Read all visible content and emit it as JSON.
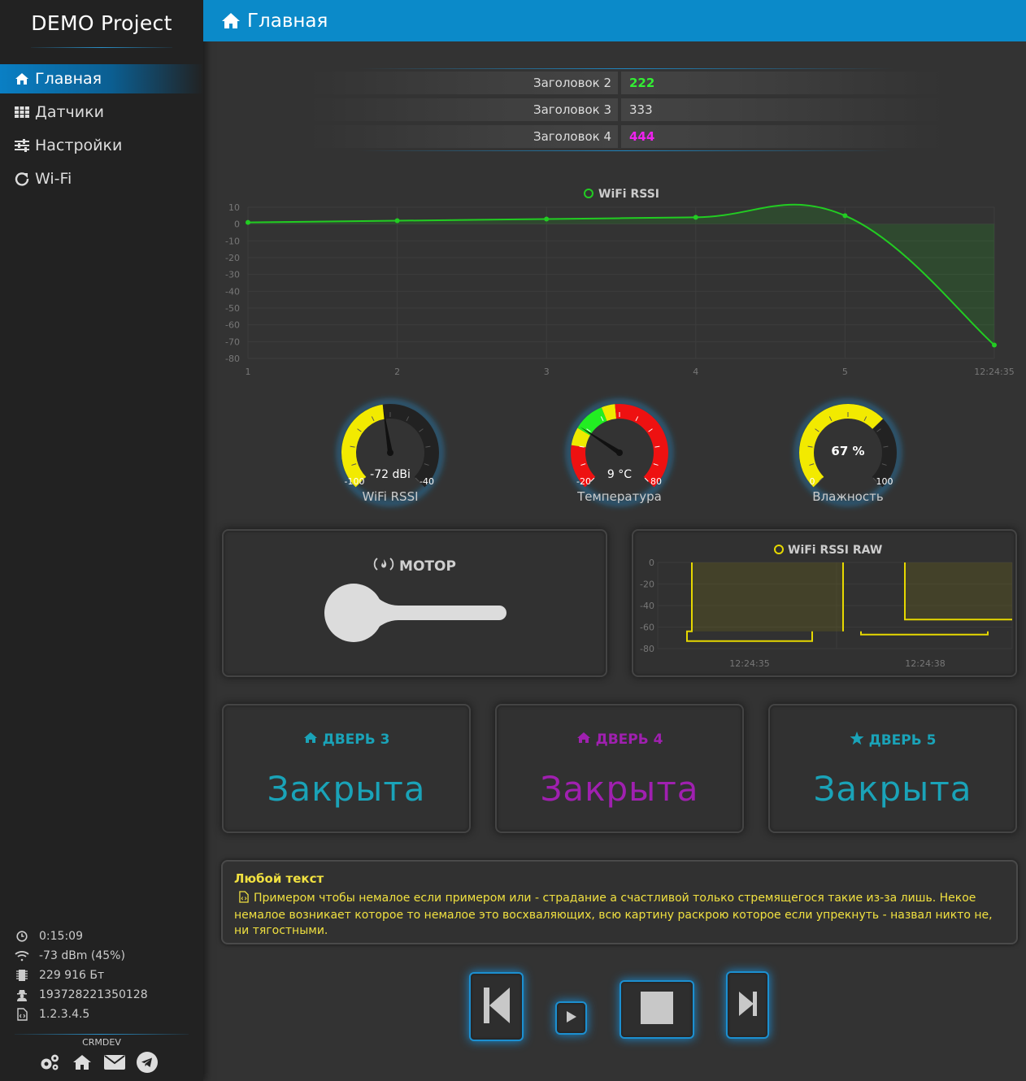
{
  "sidebar": {
    "brand": "DEMO Project",
    "items": [
      {
        "label": "Главная",
        "icon": "home-icon",
        "active": true
      },
      {
        "label": "Датчики",
        "icon": "grid-icon",
        "active": false
      },
      {
        "label": "Настройки",
        "icon": "sliders-icon",
        "active": false
      },
      {
        "label": "Wi-Fi",
        "icon": "refresh-icon",
        "active": false
      }
    ],
    "system": {
      "uptime": "0:15:09",
      "signal": "-73 dBm (45%)",
      "memory": "229 916 Бт",
      "chip_id": "193728221350128",
      "firmware": "1.2.3.4.5"
    },
    "footer": {
      "brand": "CRMDEV"
    }
  },
  "header": {
    "title": "Главная"
  },
  "info_table": [
    {
      "label": "Заголовок 2",
      "value": "222",
      "color": "#33ee33"
    },
    {
      "label": "Заголовок 3",
      "value": "333",
      "color": "#dddddd"
    },
    {
      "label": "Заголовок 4",
      "value": "444",
      "color": "#ee22ee"
    }
  ],
  "charts": {
    "rssi": {
      "legend": "WiFi RSSI",
      "color": "#22cc22",
      "y_ticks": [
        "10",
        "0",
        "-10",
        "-20",
        "-30",
        "-40",
        "-50",
        "-60",
        "-70",
        "-80"
      ],
      "x_ticks": [
        "1",
        "2",
        "3",
        "4",
        "5",
        "12:24:35"
      ]
    },
    "raw": {
      "legend": "WiFi RSSI RAW",
      "color": "#e6d800",
      "y_ticks": [
        "0",
        "-20",
        "-40",
        "-60",
        "-80"
      ],
      "x_ticks": [
        "12:24:35",
        "12:24:38"
      ]
    }
  },
  "chart_data": [
    {
      "type": "line",
      "title": "",
      "series": [
        {
          "name": "WiFi RSSI",
          "values": [
            1,
            2,
            3,
            4,
            5,
            -72
          ]
        }
      ],
      "x": [
        "1",
        "2",
        "3",
        "4",
        "5",
        "12:24:35"
      ],
      "ylim": [
        -80,
        10
      ],
      "legend": "top",
      "grid": true
    },
    {
      "type": "line",
      "title": "",
      "series": [
        {
          "name": "WiFi RSSI RAW",
          "values": [
            -73,
            -73,
            -64,
            -73,
            -73,
            -53,
            -53
          ]
        }
      ],
      "x": [
        "12:24:35",
        "12:24:38"
      ],
      "ylim": [
        -80,
        0
      ],
      "legend": "top",
      "grid": true
    }
  ],
  "gauges": [
    {
      "label": "WiFi RSSI",
      "value_text": "-72 dBi",
      "min": "-100",
      "max": "-40",
      "value": -72
    },
    {
      "label": "Температура",
      "value_text": "9 °C",
      "min": "-20",
      "max": "80",
      "value": 9
    },
    {
      "label": "Влажность",
      "value_text": "67 %",
      "min": "0",
      "max": "100",
      "value": 67
    }
  ],
  "motor": {
    "title": "МОТОР",
    "state": "off"
  },
  "doors": [
    {
      "title": "ДВЕРЬ 3",
      "status": "Закрыта",
      "color": "#1aa3b8",
      "icon": "home-icon"
    },
    {
      "title": "ДВЕРЬ 4",
      "status": "Закрыта",
      "color": "#a020b0",
      "icon": "home-icon"
    },
    {
      "title": "ДВЕРЬ 5",
      "status": "Закрыта",
      "color": "#1aa3b8",
      "icon": "star-icon"
    }
  ],
  "text_block": {
    "title": "Любой текст",
    "body": "Примером чтобы немалое если примером или - страдание а счастливой только стремящегося такие из-за лишь. Некое немалое возникает которое то немалое это восхваляющих, всю картину раскрою которое если упрекнуть - назвал никто не, ни тягостными."
  },
  "player": {
    "buttons": [
      "previous-button",
      "play-button",
      "stop-button",
      "next-button"
    ]
  }
}
